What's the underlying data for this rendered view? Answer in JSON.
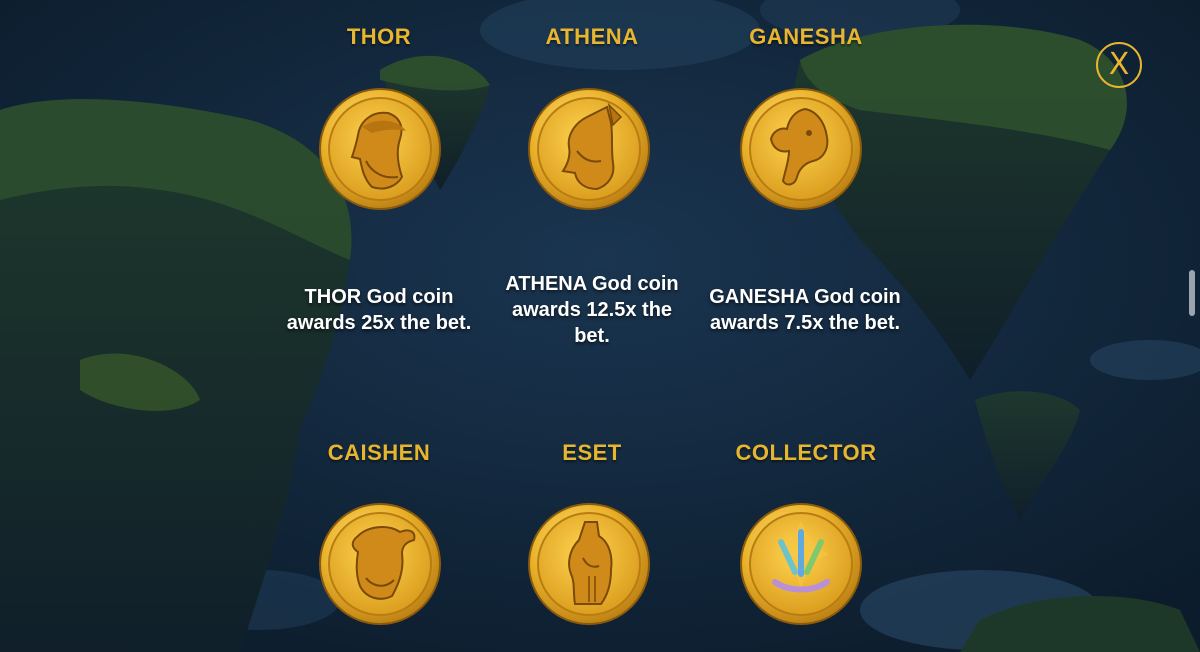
{
  "close_button": {
    "glyph": "X"
  },
  "symbols": [
    {
      "name": "THOR",
      "description": "THOR God coin awards 25x the bet.",
      "icon": "thor-coin-icon"
    },
    {
      "name": "ATHENA",
      "description": "ATHENA God coin awards 12.5x the bet.",
      "icon": "athena-coin-icon"
    },
    {
      "name": "GANESHA",
      "description": "GANESHA God coin awards 7.5x the bet.",
      "icon": "ganesha-coin-icon"
    },
    {
      "name": "CAISHEN",
      "icon": "caishen-coin-icon"
    },
    {
      "name": "ESET",
      "icon": "eset-coin-icon"
    },
    {
      "name": "COLLECTOR",
      "icon": "collector-coin-icon"
    }
  ],
  "colors": {
    "title_gold": "#e8b52e",
    "background": "#0f2133",
    "coin_gold": "#e9b327"
  }
}
